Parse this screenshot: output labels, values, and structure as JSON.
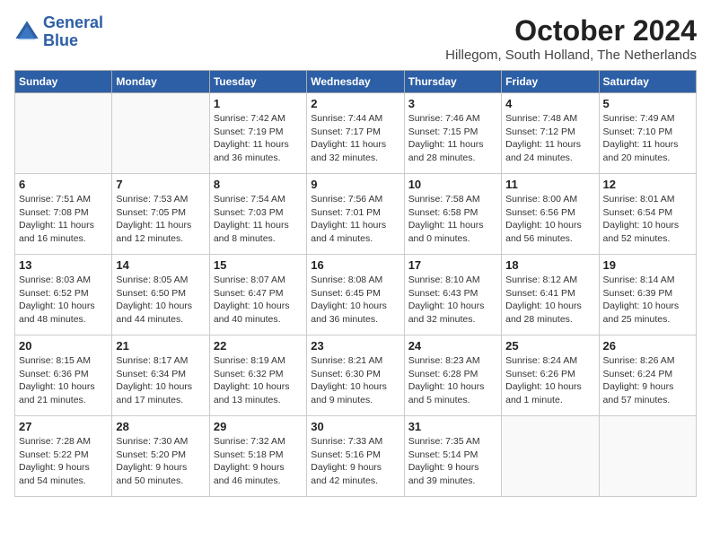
{
  "logo": {
    "line1": "General",
    "line2": "Blue"
  },
  "title": "October 2024",
  "location": "Hillegom, South Holland, The Netherlands",
  "weekdays": [
    "Sunday",
    "Monday",
    "Tuesday",
    "Wednesday",
    "Thursday",
    "Friday",
    "Saturday"
  ],
  "weeks": [
    [
      {
        "day": "",
        "info": ""
      },
      {
        "day": "",
        "info": ""
      },
      {
        "day": "1",
        "info": "Sunrise: 7:42 AM\nSunset: 7:19 PM\nDaylight: 11 hours\nand 36 minutes."
      },
      {
        "day": "2",
        "info": "Sunrise: 7:44 AM\nSunset: 7:17 PM\nDaylight: 11 hours\nand 32 minutes."
      },
      {
        "day": "3",
        "info": "Sunrise: 7:46 AM\nSunset: 7:15 PM\nDaylight: 11 hours\nand 28 minutes."
      },
      {
        "day": "4",
        "info": "Sunrise: 7:48 AM\nSunset: 7:12 PM\nDaylight: 11 hours\nand 24 minutes."
      },
      {
        "day": "5",
        "info": "Sunrise: 7:49 AM\nSunset: 7:10 PM\nDaylight: 11 hours\nand 20 minutes."
      }
    ],
    [
      {
        "day": "6",
        "info": "Sunrise: 7:51 AM\nSunset: 7:08 PM\nDaylight: 11 hours\nand 16 minutes."
      },
      {
        "day": "7",
        "info": "Sunrise: 7:53 AM\nSunset: 7:05 PM\nDaylight: 11 hours\nand 12 minutes."
      },
      {
        "day": "8",
        "info": "Sunrise: 7:54 AM\nSunset: 7:03 PM\nDaylight: 11 hours\nand 8 minutes."
      },
      {
        "day": "9",
        "info": "Sunrise: 7:56 AM\nSunset: 7:01 PM\nDaylight: 11 hours\nand 4 minutes."
      },
      {
        "day": "10",
        "info": "Sunrise: 7:58 AM\nSunset: 6:58 PM\nDaylight: 11 hours\nand 0 minutes."
      },
      {
        "day": "11",
        "info": "Sunrise: 8:00 AM\nSunset: 6:56 PM\nDaylight: 10 hours\nand 56 minutes."
      },
      {
        "day": "12",
        "info": "Sunrise: 8:01 AM\nSunset: 6:54 PM\nDaylight: 10 hours\nand 52 minutes."
      }
    ],
    [
      {
        "day": "13",
        "info": "Sunrise: 8:03 AM\nSunset: 6:52 PM\nDaylight: 10 hours\nand 48 minutes."
      },
      {
        "day": "14",
        "info": "Sunrise: 8:05 AM\nSunset: 6:50 PM\nDaylight: 10 hours\nand 44 minutes."
      },
      {
        "day": "15",
        "info": "Sunrise: 8:07 AM\nSunset: 6:47 PM\nDaylight: 10 hours\nand 40 minutes."
      },
      {
        "day": "16",
        "info": "Sunrise: 8:08 AM\nSunset: 6:45 PM\nDaylight: 10 hours\nand 36 minutes."
      },
      {
        "day": "17",
        "info": "Sunrise: 8:10 AM\nSunset: 6:43 PM\nDaylight: 10 hours\nand 32 minutes."
      },
      {
        "day": "18",
        "info": "Sunrise: 8:12 AM\nSunset: 6:41 PM\nDaylight: 10 hours\nand 28 minutes."
      },
      {
        "day": "19",
        "info": "Sunrise: 8:14 AM\nSunset: 6:39 PM\nDaylight: 10 hours\nand 25 minutes."
      }
    ],
    [
      {
        "day": "20",
        "info": "Sunrise: 8:15 AM\nSunset: 6:36 PM\nDaylight: 10 hours\nand 21 minutes."
      },
      {
        "day": "21",
        "info": "Sunrise: 8:17 AM\nSunset: 6:34 PM\nDaylight: 10 hours\nand 17 minutes."
      },
      {
        "day": "22",
        "info": "Sunrise: 8:19 AM\nSunset: 6:32 PM\nDaylight: 10 hours\nand 13 minutes."
      },
      {
        "day": "23",
        "info": "Sunrise: 8:21 AM\nSunset: 6:30 PM\nDaylight: 10 hours\nand 9 minutes."
      },
      {
        "day": "24",
        "info": "Sunrise: 8:23 AM\nSunset: 6:28 PM\nDaylight: 10 hours\nand 5 minutes."
      },
      {
        "day": "25",
        "info": "Sunrise: 8:24 AM\nSunset: 6:26 PM\nDaylight: 10 hours\nand 1 minute."
      },
      {
        "day": "26",
        "info": "Sunrise: 8:26 AM\nSunset: 6:24 PM\nDaylight: 9 hours\nand 57 minutes."
      }
    ],
    [
      {
        "day": "27",
        "info": "Sunrise: 7:28 AM\nSunset: 5:22 PM\nDaylight: 9 hours\nand 54 minutes."
      },
      {
        "day": "28",
        "info": "Sunrise: 7:30 AM\nSunset: 5:20 PM\nDaylight: 9 hours\nand 50 minutes."
      },
      {
        "day": "29",
        "info": "Sunrise: 7:32 AM\nSunset: 5:18 PM\nDaylight: 9 hours\nand 46 minutes."
      },
      {
        "day": "30",
        "info": "Sunrise: 7:33 AM\nSunset: 5:16 PM\nDaylight: 9 hours\nand 42 minutes."
      },
      {
        "day": "31",
        "info": "Sunrise: 7:35 AM\nSunset: 5:14 PM\nDaylight: 9 hours\nand 39 minutes."
      },
      {
        "day": "",
        "info": ""
      },
      {
        "day": "",
        "info": ""
      }
    ]
  ]
}
